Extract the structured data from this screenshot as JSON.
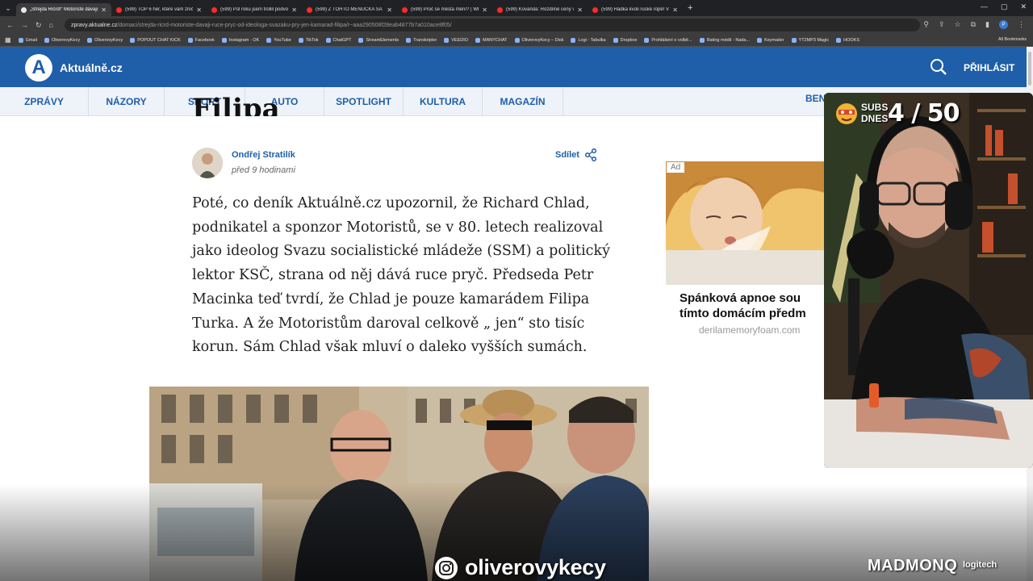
{
  "browser": {
    "tabs": [
      {
        "title": "„Strejda Ričrd!“ Motoristé dávají",
        "active": true
      },
      {
        "title": "(599) TOP 6 her, které vám zničí",
        "active": false
      },
      {
        "title": "(599) Půl roku jsem trollil podvo",
        "active": false
      },
      {
        "title": "(599) Z TOHTO MENUČKA SA T",
        "active": false
      },
      {
        "title": "(599) Proč se města mění? | Wh",
        "active": false
      },
      {
        "title": "(599) Kovanda: Rozdílné ceny v",
        "active": false
      },
      {
        "title": "(599) Hádka kvůli ruské ropě! V",
        "active": false
      }
    ],
    "url_host": "zpravy.aktualne.cz",
    "url_path": "/domaci/strejda-ricrd-motoriste-davaji-ruce-pryc-od-ideologa-svazaku-pry-jen-kamarad-filipa/r~aaa290508f28eab4877b7a010ace8f05/",
    "profile_initial": "P",
    "bookmarks": [
      "Gmail",
      "OliverovyKecy",
      "OliverovyKecy",
      "POPOUT CHAT KICK",
      "Facebook",
      "Instagram - OK",
      "YouTube",
      "TikTok",
      "ChatGPT",
      "StreamElements",
      "Transkriptor",
      "VEEDIO",
      "MANYCHAT",
      "OliverovyKecy – Disk",
      "Logi - Tabulka",
      "Dropbox",
      "Prohlášení o volbě...",
      "Rating médií - Nada...",
      "Keymailer",
      "YT2MP3 Magic",
      "HOOKS"
    ],
    "all_bookmarks": "All Bookmarks"
  },
  "site": {
    "logo_letter": "A",
    "logo_text": "Aktuálně.cz",
    "login": "PŘIHLÁSIT",
    "nav": [
      "ZPRÁVY",
      "NÁZORY",
      "SPORT",
      "AUTO",
      "SPOTLIGHT",
      "KULTURA",
      "MAGAZÍN"
    ],
    "nav_clipped": "BEN",
    "brand_color": "#1f5ea8"
  },
  "article": {
    "headline_tail": "Filipa",
    "author": "Ondřej Stratilík",
    "time": "před 9 hodinami",
    "share": "Sdílet",
    "body": "Poté, co deník Aktuálně.cz upozornil, že Richard Chlad, podnikatel a sponzor Motoristů, se v 80. letech realizoval jako ideolog Svazu socialistické mládeže (SSM) a politický lektor KSČ, strana od něj dává ruce pryč. Předseda Petr Macinka teď tvrdí, že Chlad je pouze kamarádem Filipa Turka. A že Motoristům daroval celkově „ jen“ sto tisíc korun. Sám Chlad však mluví o daleko vyšších sumách."
  },
  "ad": {
    "label": "Ad",
    "title_line1": "Spánková apnoe sou",
    "title_line2": "tímto domácím předm",
    "domain": "derilamemoryfoam.com"
  },
  "overlay": {
    "subs_label_top": "SUBS",
    "subs_label_bottom": "DNES",
    "subs_count": "4 / 50",
    "instagram_handle": "oliverovykecy",
    "brand": "MADMONQ",
    "brand_sub": "logitech"
  }
}
